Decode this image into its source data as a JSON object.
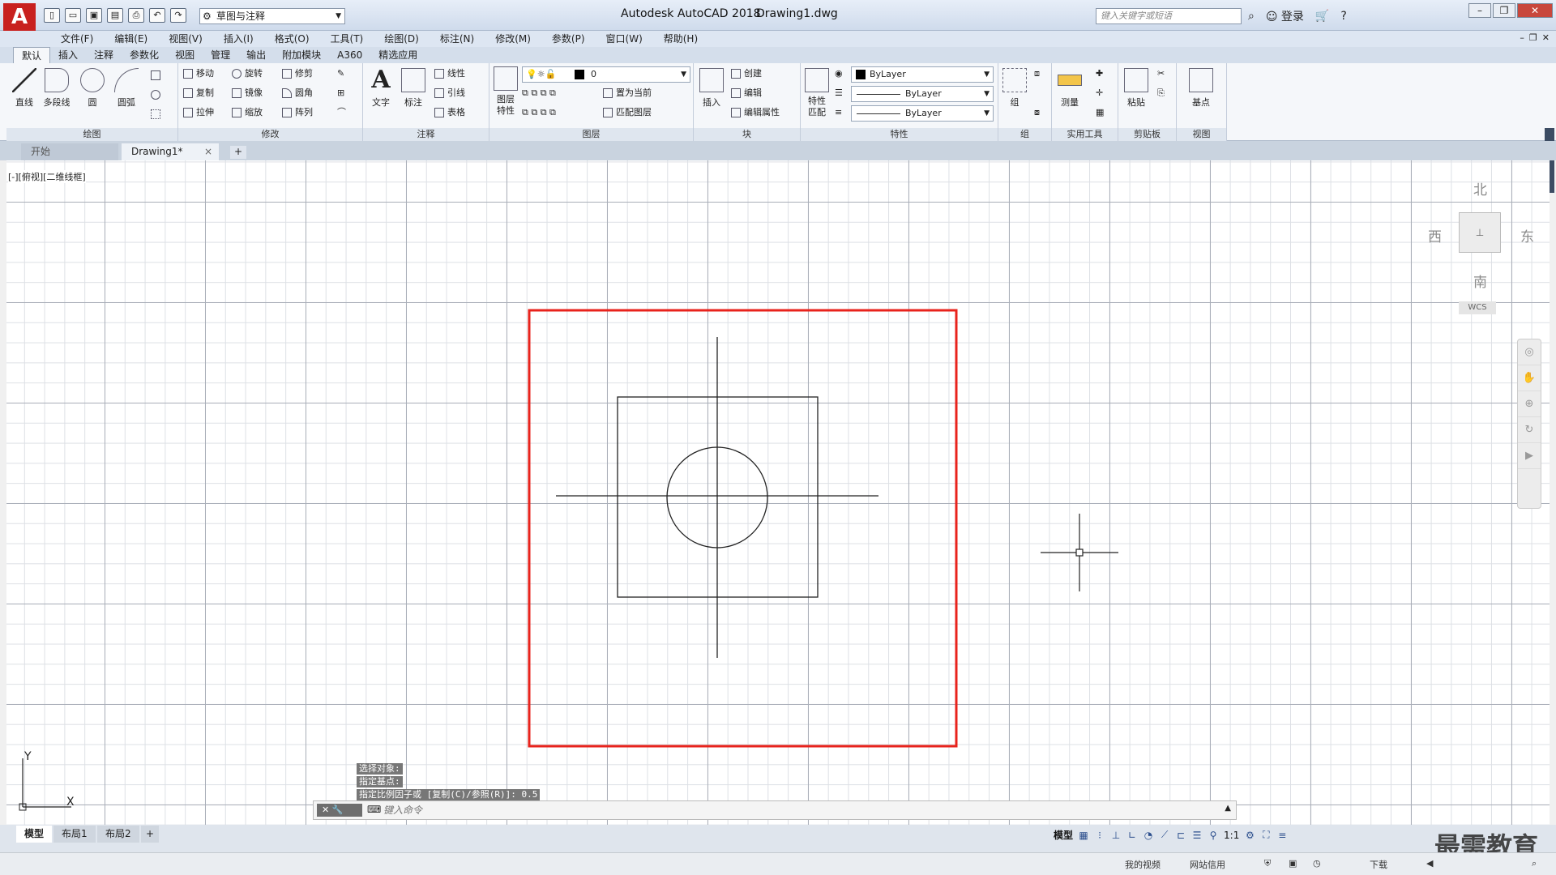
{
  "titlebar": {
    "logo": "A",
    "workspace": "草图与注释",
    "app_title": "Autodesk AutoCAD 2018",
    "file_name": "Drawing1.dwg",
    "search_placeholder": "键入关键字或短语",
    "signin": "登录"
  },
  "menu": [
    "文件(F)",
    "编辑(E)",
    "视图(V)",
    "插入(I)",
    "格式(O)",
    "工具(T)",
    "绘图(D)",
    "标注(N)",
    "修改(M)",
    "参数(P)",
    "窗口(W)",
    "帮助(H)"
  ],
  "ribbon_tabs": [
    "默认",
    "插入",
    "注释",
    "参数化",
    "视图",
    "管理",
    "输出",
    "附加模块",
    "A360",
    "精选应用"
  ],
  "ribbon": {
    "draw": {
      "title": "绘图",
      "line": "直线",
      "polyline": "多段线",
      "circle": "圆",
      "arc": "圆弧"
    },
    "modify": {
      "title": "修改",
      "move": "移动",
      "rotate": "旋转",
      "trim": "修剪",
      "copy": "复制",
      "mirror": "镜像",
      "fillet": "圆角",
      "stretch": "拉伸",
      "scale": "缩放",
      "array": "阵列"
    },
    "annotation": {
      "title": "注释",
      "text": "文字",
      "dimension": "标注",
      "linear": "线性",
      "leader": "引线",
      "table": "表格"
    },
    "layers": {
      "title": "图层",
      "layer_props": "图层\n特性",
      "current_layer": "0",
      "set_current": "置为当前",
      "match_layer": "匹配图层"
    },
    "block": {
      "title": "块",
      "insert": "插入",
      "create": "创建",
      "edit": "编辑",
      "edit_attr": "编辑属性"
    },
    "properties": {
      "title": "特性",
      "match": "特性\n匹配",
      "color": "ByLayer",
      "linetype": "ByLayer",
      "lineweight": "ByLayer"
    },
    "groups": {
      "title": "组",
      "group": "组"
    },
    "utilities": {
      "title": "实用工具",
      "measure": "测量"
    },
    "clipboard": {
      "title": "剪贴板",
      "paste": "粘贴"
    },
    "view": {
      "title": "视图",
      "base": "基点"
    }
  },
  "doc_tabs": {
    "start": "开始",
    "drawing": "Drawing1*"
  },
  "viewport": {
    "label": "[-][俯视][二维线框]",
    "compass": {
      "n": "北",
      "s": "南",
      "e": "东",
      "w": "西"
    },
    "wcs": "WCS"
  },
  "command": {
    "history": [
      "选择对象:",
      "指定基点:",
      "指定比例因子或 [复制(C)/参照(R)]: 0.5"
    ],
    "placeholder": "键入命令"
  },
  "ucs": {
    "x": "X",
    "y": "Y"
  },
  "layout_tabs": [
    "模型",
    "布局1",
    "布局2"
  ],
  "status": {
    "model": "模型",
    "scale": "1:1"
  },
  "bottom": {
    "videos": "我的视频",
    "credit": "网站信用",
    "download": "下载"
  },
  "watermark": "最需教育",
  "colors": {
    "highlight": "#e8231c",
    "accent": "#c8201e"
  }
}
